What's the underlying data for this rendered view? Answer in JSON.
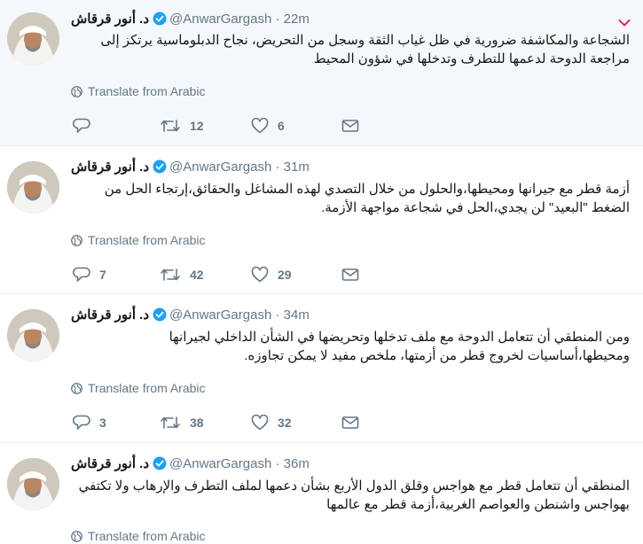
{
  "tweets": [
    {
      "fullname": "د. أنور قرقاش",
      "username": "@AnwarGargash",
      "time": "22m",
      "text": "الشجاعة والمكاشفة ضرورية في ظل غياب الثقة وسجل من التحريض، نجاح الدبلوماسية يرتكز إلى مراجعة الدوحة لدعمها للتطرف وتدخلها في شؤون المحيط",
      "translate": "Translate from Arabic",
      "replies": "",
      "retweets": "12",
      "likes": "6",
      "highlight": true
    },
    {
      "fullname": "د. أنور قرقاش",
      "username": "@AnwarGargash",
      "time": "31m",
      "text": "أزمة قطر مع جيرانها ومحيطها،والحلول من خلال التصدي لهذه المشاغل والحقائق،إرتجاء الحل من الضغط \"البعيد\" لن يجدي،الحل في شجاعة مواجهة الأزمة.",
      "translate": "Translate from Arabic",
      "replies": "7",
      "retweets": "42",
      "likes": "29"
    },
    {
      "fullname": "د. أنور قرقاش",
      "username": "@AnwarGargash",
      "time": "34m",
      "text": "ومن المنطقي أن تتعامل الدوحة مع ملف تدخلها وتحريضها في الشأن الداخلي لجيرانها ومحيطها،أساسيات لخروج قطر من أزمتها، ملخص مفيد لا يمكن تجاوزه.",
      "translate": "Translate from Arabic",
      "replies": "3",
      "retweets": "38",
      "likes": "32"
    },
    {
      "fullname": "د. أنور قرقاش",
      "username": "@AnwarGargash",
      "time": "36m",
      "text": "المنطقي أن تتعامل قطر مع هواجس وقلق الدول الأربع بشأن دعمها لملف التطرف والإرهاب ولا تكتفي بهواجس واشنطن والعواصم الغربية،أزمة قطر مع عالمها",
      "translate": "Translate from Arabic"
    }
  ],
  "colors": {
    "text": "#14171a",
    "secondary": "#657786",
    "verified": "#1da1f2",
    "caret": "#e0245e",
    "highlight_bg": "#f5f8fa"
  }
}
